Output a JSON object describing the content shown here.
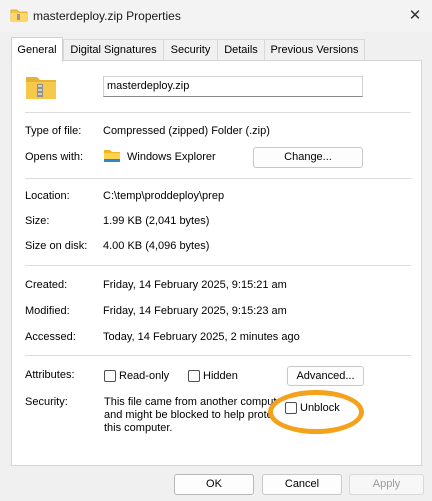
{
  "window": {
    "title": "masterdeploy.zip Properties",
    "close_glyph": "✕"
  },
  "tabs": [
    {
      "label": "General",
      "active": true
    },
    {
      "label": "Digital Signatures"
    },
    {
      "label": "Security"
    },
    {
      "label": "Details"
    },
    {
      "label": "Previous Versions"
    }
  ],
  "file": {
    "name": "masterdeploy.zip",
    "icon": "zip-folder-icon"
  },
  "labels": {
    "type": "Type of file:",
    "opens": "Opens with:",
    "location": "Location:",
    "size": "Size:",
    "size_disk": "Size on disk:",
    "created": "Created:",
    "modified": "Modified:",
    "accessed": "Accessed:",
    "attributes": "Attributes:",
    "security": "Security:"
  },
  "values": {
    "type": "Compressed (zipped) Folder (.zip)",
    "opens_app": "Windows Explorer",
    "location": "C:\\temp\\proddeploy\\prep",
    "size": "1.99 KB (2,041 bytes)",
    "size_disk": "4.00 KB (4,096 bytes)",
    "created": "Friday, 14 February 2025, 9:15:21 am",
    "modified": "Friday, 14 February 2025, 9:15:23 am",
    "accessed": "Today, 14 February 2025, 2 minutes ago",
    "security_line1": "This file came from another comput",
    "security_line2": "and might be blocked to help prote",
    "security_line3": "this computer."
  },
  "buttons": {
    "change": "Change...",
    "advanced": "Advanced...",
    "ok": "OK",
    "cancel": "Cancel",
    "apply": "Apply"
  },
  "attributes": {
    "readonly": "Read-only",
    "hidden": "Hidden",
    "unblock": "Unblock"
  },
  "colors": {
    "highlight": "#f4a11b",
    "folder": "#f5c242"
  }
}
